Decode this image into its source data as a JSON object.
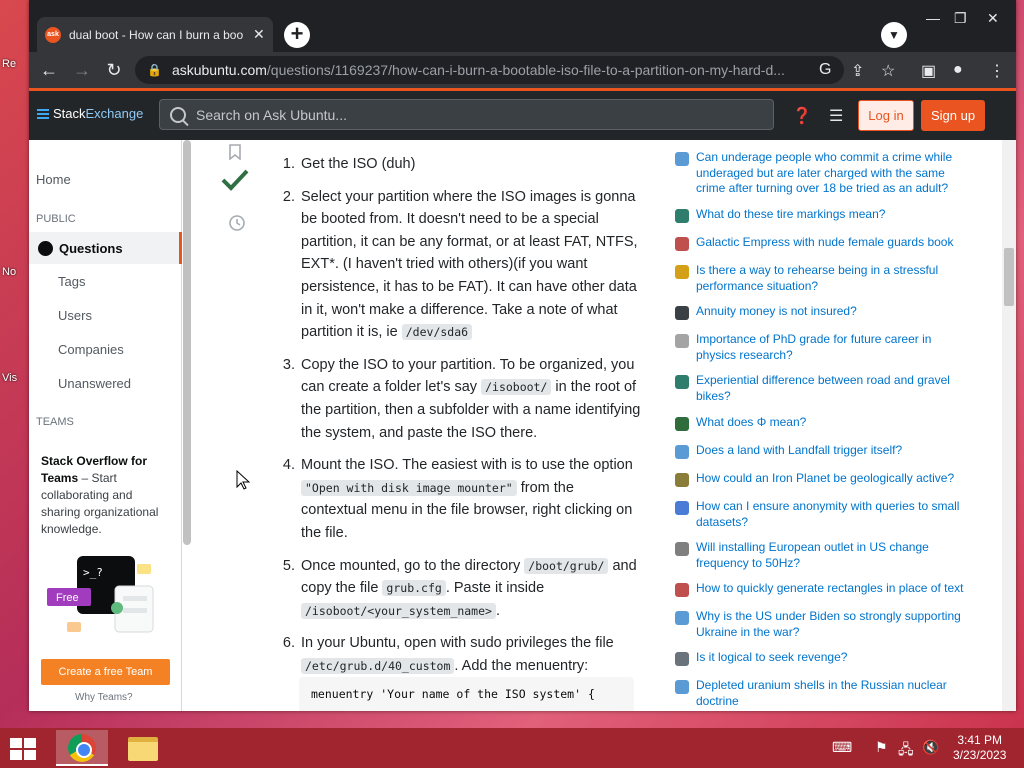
{
  "browser": {
    "tab_title": "dual boot - How can I burn a boo",
    "favicon_text": "ask",
    "url_host": "askubuntu.com",
    "url_path": "/questions/1169237/how-can-i-burn-a-bootable-iso-file-to-a-partition-on-my-hard-d..."
  },
  "site": {
    "logo_stack": "Stack",
    "logo_exchange": "Exchange",
    "search_placeholder": "Search on Ask Ubuntu...",
    "login_label": "Log in",
    "signup_label": "Sign up"
  },
  "leftnav": {
    "home": "Home",
    "public_header": "PUBLIC",
    "questions": "Questions",
    "tags": "Tags",
    "users": "Users",
    "companies": "Companies",
    "unanswered": "Unanswered",
    "teams_header": "TEAMS",
    "teams_title": "Stack Overflow for Teams",
    "teams_desc": " – Start collaborating and sharing organizational knowledge.",
    "free_badge": "Free",
    "create_team": "Create a free Team",
    "why_teams": "Why Teams?"
  },
  "answer": {
    "step1": "Get the ISO (duh)",
    "step2_text": "Select your partition where the ISO images is gonna be booted from. It doesn't need to be a special partition, it can be any format, or at least FAT, NTFS, EXT*. (I haven't tried with others)(if you want persistence, it has to be FAT). It can have other data in it, won't make a difference. Take a note of what partition it is, ie ",
    "step2_code": "/dev/sda6",
    "step3_a": "Copy the ISO to your partition. To be organized, you can create a folder let's say ",
    "step3_code": "/isoboot/",
    "step3_b": " in the root of the partition, then a subfolder with a name identifying the system, and paste the ISO there.",
    "step4_a": "Mount the ISO. The easiest with is to use the option ",
    "step4_code": "\"Open with disk image mounter\"",
    "step4_b": " from the contextual menu in the file browser, right clicking on the file.",
    "step5_a": "Once mounted, go to the directory ",
    "step5_code1": "/boot/grub/",
    "step5_b": " and copy the file ",
    "step5_code2": "grub.cfg",
    "step5_c": ". Paste it inside ",
    "step5_code3": "/isoboot/<your_system_name>",
    "step5_d": ".",
    "step6_a": "In your Ubuntu, open with sudo privileges the file ",
    "step6_code": "/etc/grub.d/40_custom",
    "step6_b": ". Add the menuentry:",
    "codeblock": "menuentry 'Your name of the ISO system' {"
  },
  "hot_questions": [
    {
      "text": "Can underage people who commit a crime while underaged but are later charged with the same crime after turning over 18 be tried as an adult?",
      "color": "#5b9bd5"
    },
    {
      "text": "What do these tire markings mean?",
      "color": "#2f7d6d"
    },
    {
      "text": "Galactic Empress with nude female guards book",
      "color": "#c0504d"
    },
    {
      "text": "Is there a way to rehearse being in a stressful performance situation?",
      "color": "#d4a017"
    },
    {
      "text": "Annuity money is not insured?",
      "color": "#3b4045"
    },
    {
      "text": "Importance of PhD grade for future career in physics research?",
      "color": "#a4a4a4"
    },
    {
      "text": "Experiential difference between road and gravel bikes?",
      "color": "#2f7d6d"
    },
    {
      "text": "What does Φ mean?",
      "color": "#2f6d3d"
    },
    {
      "text": "Does a land with Landfall trigger itself?",
      "color": "#5b9bd5"
    },
    {
      "text": "How could an Iron Planet be geologically active?",
      "color": "#8a7d3a"
    },
    {
      "text": "How can I ensure anonymity with queries to small datasets?",
      "color": "#4a7bd5"
    },
    {
      "text": "Will installing European outlet in US change frequency to 50Hz?",
      "color": "#7f7f7f"
    },
    {
      "text": "How to quickly generate rectangles in place of text",
      "color": "#c0504d"
    },
    {
      "text": "Why is the US under Biden so strongly supporting Ukraine in the war?",
      "color": "#5b9bd5"
    },
    {
      "text": "Is it logical to seek revenge?",
      "color": "#6a737c"
    },
    {
      "text": "Depleted uranium shells in the Russian nuclear doctrine",
      "color": "#5b9bd5"
    }
  ],
  "taskbar": {
    "time": "3:41 PM",
    "date": "3/23/2023"
  },
  "desktop": {
    "label_re": "Re",
    "label_no": "No",
    "label_vis": "Vis"
  }
}
